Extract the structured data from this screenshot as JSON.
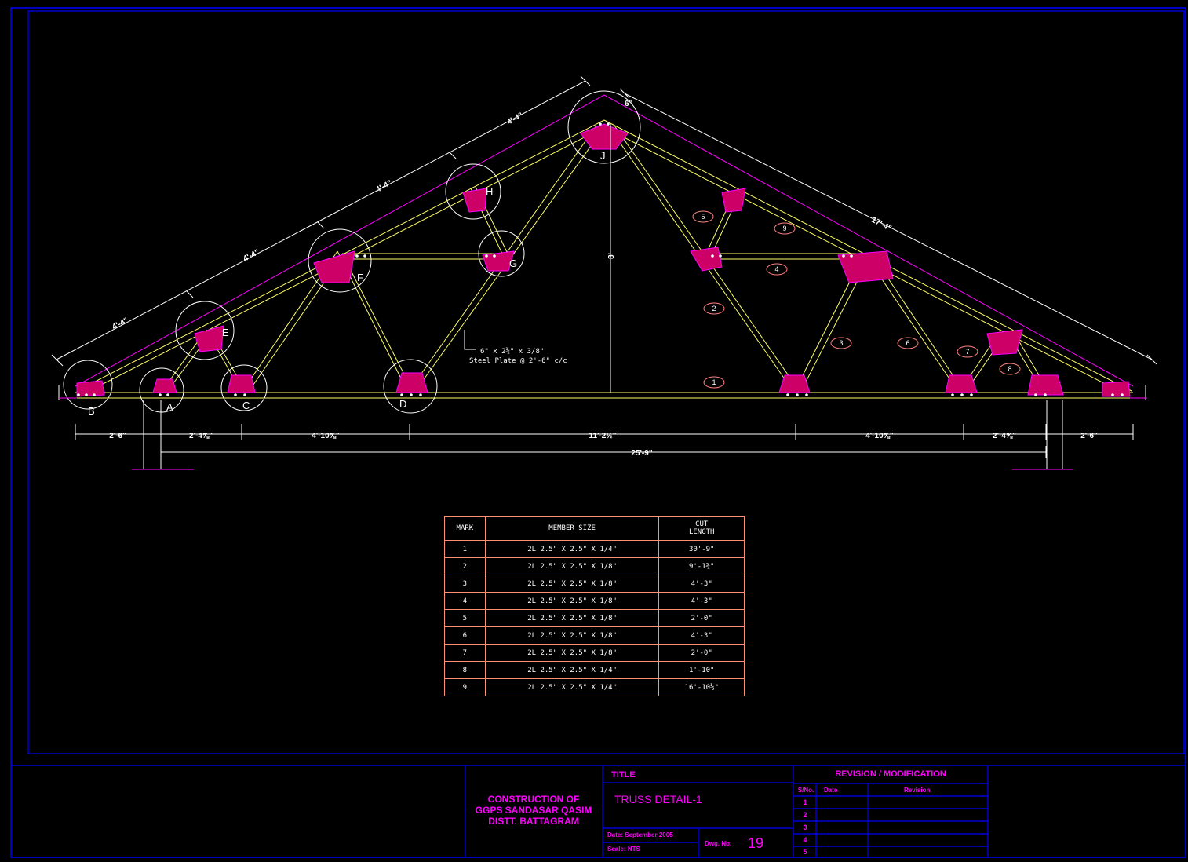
{
  "drawing": {
    "joint_labels": [
      "B",
      "A",
      "E",
      "C",
      "F",
      "D",
      "H",
      "G",
      "J"
    ],
    "member_marks": [
      "1",
      "2",
      "3",
      "4",
      "5",
      "6",
      "7",
      "8",
      "9"
    ],
    "slope_dims_left": [
      "4'-4\"",
      "4'-4\"",
      "4'-4\"",
      "4'-4\""
    ],
    "slope_dim_right": "17'-4\"",
    "apex_offset": "6\"",
    "rise": "8'",
    "plate_note_line1": "6\" x 2½\" x 3/8\"",
    "plate_note_line2": "Steel Plate @ 2'-6\" c/c",
    "bottom_dims": [
      "2'-6\"",
      "2'-4⅝\"",
      "4'-10⅝\"",
      "11'-2½\"",
      "4'-10⅝\"",
      "2'-4⅝\"",
      "2'-6\""
    ],
    "overall_dim": "25'-9\""
  },
  "schedule": {
    "headers": {
      "mark": "MARK",
      "member": "MEMBER SIZE",
      "cut": "CUT\nLENGTH"
    },
    "rows": [
      {
        "mark": "1",
        "member": "2L 2.5\" X 2.5\" X 1/4\"",
        "cut": "30'-9\""
      },
      {
        "mark": "2",
        "member": "2L 2.5\" X 2.5\" X 1/8\"",
        "cut": "9'-1¾\""
      },
      {
        "mark": "3",
        "member": "2L 2.5\" X 2.5\" X 1/8\"",
        "cut": "4'-3\""
      },
      {
        "mark": "4",
        "member": "2L 2.5\" X 2.5\" X 1/8\"",
        "cut": "4'-3\""
      },
      {
        "mark": "5",
        "member": "2L 2.5\" X 2.5\" X 1/8\"",
        "cut": "2'-0\""
      },
      {
        "mark": "6",
        "member": "2L 2.5\" X 2.5\" X 1/8\"",
        "cut": "4'-3\""
      },
      {
        "mark": "7",
        "member": "2L 2.5\" X 2.5\" X 1/8\"",
        "cut": "2'-0\""
      },
      {
        "mark": "8",
        "member": "2L 2.5\" X 2.5\" X 1/4\"",
        "cut": "1'-10\""
      },
      {
        "mark": "9",
        "member": "2L 2.5\" X 2.5\" X 1/4\"",
        "cut": "16'-10½\""
      }
    ]
  },
  "title_block": {
    "project_line1": "CONSTRUCTION OF",
    "project_line2": "GGPS SANDASAR QASIM",
    "project_line3": "DISTT. BATTAGRAM",
    "title_label": "TITLE",
    "title": "TRUSS DETAIL-1",
    "date_label": "Date:",
    "date": "September 2005",
    "scale_label": "Scale:",
    "scale": "NTS",
    "dwg_label": "Dwg. No.",
    "dwg_no": "19",
    "revision_header": "REVISION / MODIFICATION",
    "rev_cols": [
      "S/No.",
      "Date",
      "Revision"
    ],
    "rev_rows": [
      "1",
      "2",
      "3",
      "4",
      "5"
    ]
  },
  "colors": {
    "border": "#0000ff",
    "truss": "#ffff66",
    "plates": "#ff00ff",
    "dims": "#ffffff",
    "schedule_lines": "#ff9070",
    "title_text": "#ff00ff"
  }
}
